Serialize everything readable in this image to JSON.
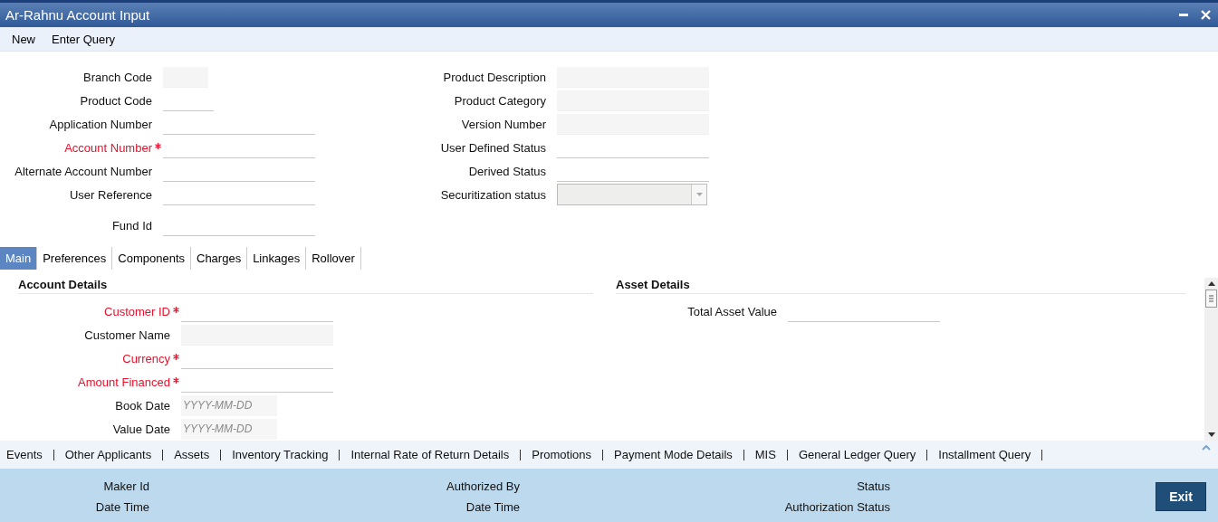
{
  "window": {
    "title": "Ar-Rahnu Account Input"
  },
  "menu": [
    "New",
    "Enter Query"
  ],
  "header": {
    "left": [
      {
        "label": "Branch Code",
        "required": false,
        "kind": "short-readonly"
      },
      {
        "label": "Product Code",
        "required": false,
        "kind": "short-text"
      },
      {
        "label": "Application Number",
        "required": false,
        "kind": "text"
      },
      {
        "label": "Account Number",
        "required": true,
        "kind": "text"
      },
      {
        "label": "Alternate Account Number",
        "required": false,
        "kind": "text"
      },
      {
        "label": "User Reference",
        "required": false,
        "kind": "text"
      },
      {
        "label": "Fund Id",
        "required": false,
        "kind": "text"
      }
    ],
    "right": [
      {
        "label": "Product Description",
        "required": false,
        "kind": "readonly"
      },
      {
        "label": "Product Category",
        "required": false,
        "kind": "readonly"
      },
      {
        "label": "Version Number",
        "required": false,
        "kind": "readonly"
      },
      {
        "label": "User Defined Status",
        "required": false,
        "kind": "text"
      },
      {
        "label": "Derived Status",
        "required": false,
        "kind": "text"
      },
      {
        "label": "Securitization status",
        "required": false,
        "kind": "select"
      }
    ]
  },
  "tabs": [
    {
      "label": "Main",
      "selected": true
    },
    {
      "label": "Preferences",
      "selected": false
    },
    {
      "label": "Components",
      "selected": false
    },
    {
      "label": "Charges",
      "selected": false
    },
    {
      "label": "Linkages",
      "selected": false
    },
    {
      "label": "Rollover",
      "selected": false
    }
  ],
  "sections": [
    {
      "title": "Account Details",
      "fields": [
        {
          "label": "Customer ID",
          "required": true,
          "kind": "text"
        },
        {
          "label": "Customer Name",
          "required": false,
          "kind": "readonly"
        },
        {
          "label": "Currency",
          "required": true,
          "kind": "text"
        },
        {
          "label": "Amount Financed",
          "required": true,
          "kind": "text"
        },
        {
          "label": "Book Date",
          "required": false,
          "kind": "date",
          "placeholder": "YYYY-MM-DD"
        },
        {
          "label": "Value Date",
          "required": false,
          "kind": "date",
          "placeholder": "YYYY-MM-DD"
        }
      ]
    },
    {
      "title": "Asset Details",
      "fields": [
        {
          "label": "Total Asset Value",
          "required": false,
          "kind": "text"
        }
      ]
    }
  ],
  "links": [
    "Events",
    "Other Applicants",
    "Assets",
    "Inventory Tracking",
    "Internal Rate of Return Details",
    "Promotions",
    "Payment Mode Details",
    "MIS",
    "General Ledger Query",
    "Installment Query"
  ],
  "footer": [
    [
      "Maker Id",
      "Date Time"
    ],
    [
      "Authorized By",
      "Date Time"
    ],
    [
      "Status",
      "Authorization Status"
    ]
  ],
  "exit_button": "Exit"
}
